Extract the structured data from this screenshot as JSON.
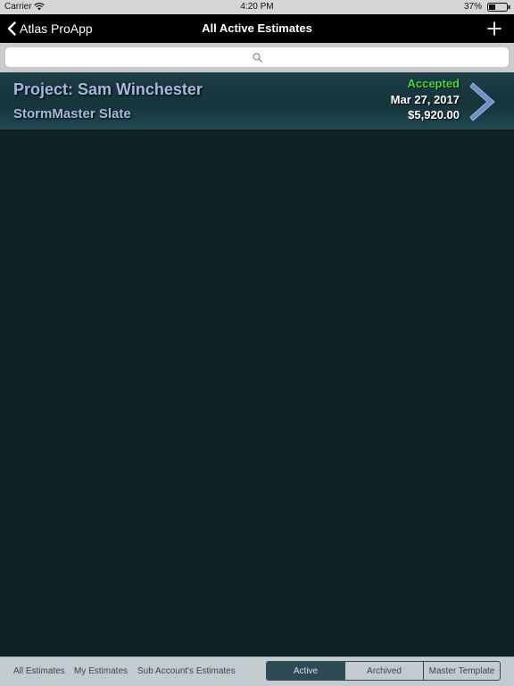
{
  "status_bar": {
    "carrier": "Carrier",
    "time": "4:20 PM",
    "battery": "37%",
    "battery_level": 0.37
  },
  "nav": {
    "back_label": "Atlas ProApp",
    "title": "All Active Estimates",
    "add_icon": "plus-icon"
  },
  "search": {
    "placeholder": "",
    "icon": "search-icon"
  },
  "estimates": [
    {
      "project": "Project: Sam Winchester",
      "product": "StormMaster Slate",
      "status": "Accepted",
      "date": "Mar 27, 2017",
      "amount": "$5,920.00"
    }
  ],
  "bottom_bar": {
    "filters": [
      "All Estimates",
      "My Estimates",
      "Sub Account's Estimates"
    ],
    "segments": [
      "Active",
      "Archived",
      "Master Template"
    ],
    "selected_segment": "Active"
  },
  "colors": {
    "background": "#0e2126",
    "accent": "#2d4a55",
    "status_accepted": "#3ddc3d",
    "title_text": "#a8b8dc",
    "chevron": "#6f8fc4"
  }
}
